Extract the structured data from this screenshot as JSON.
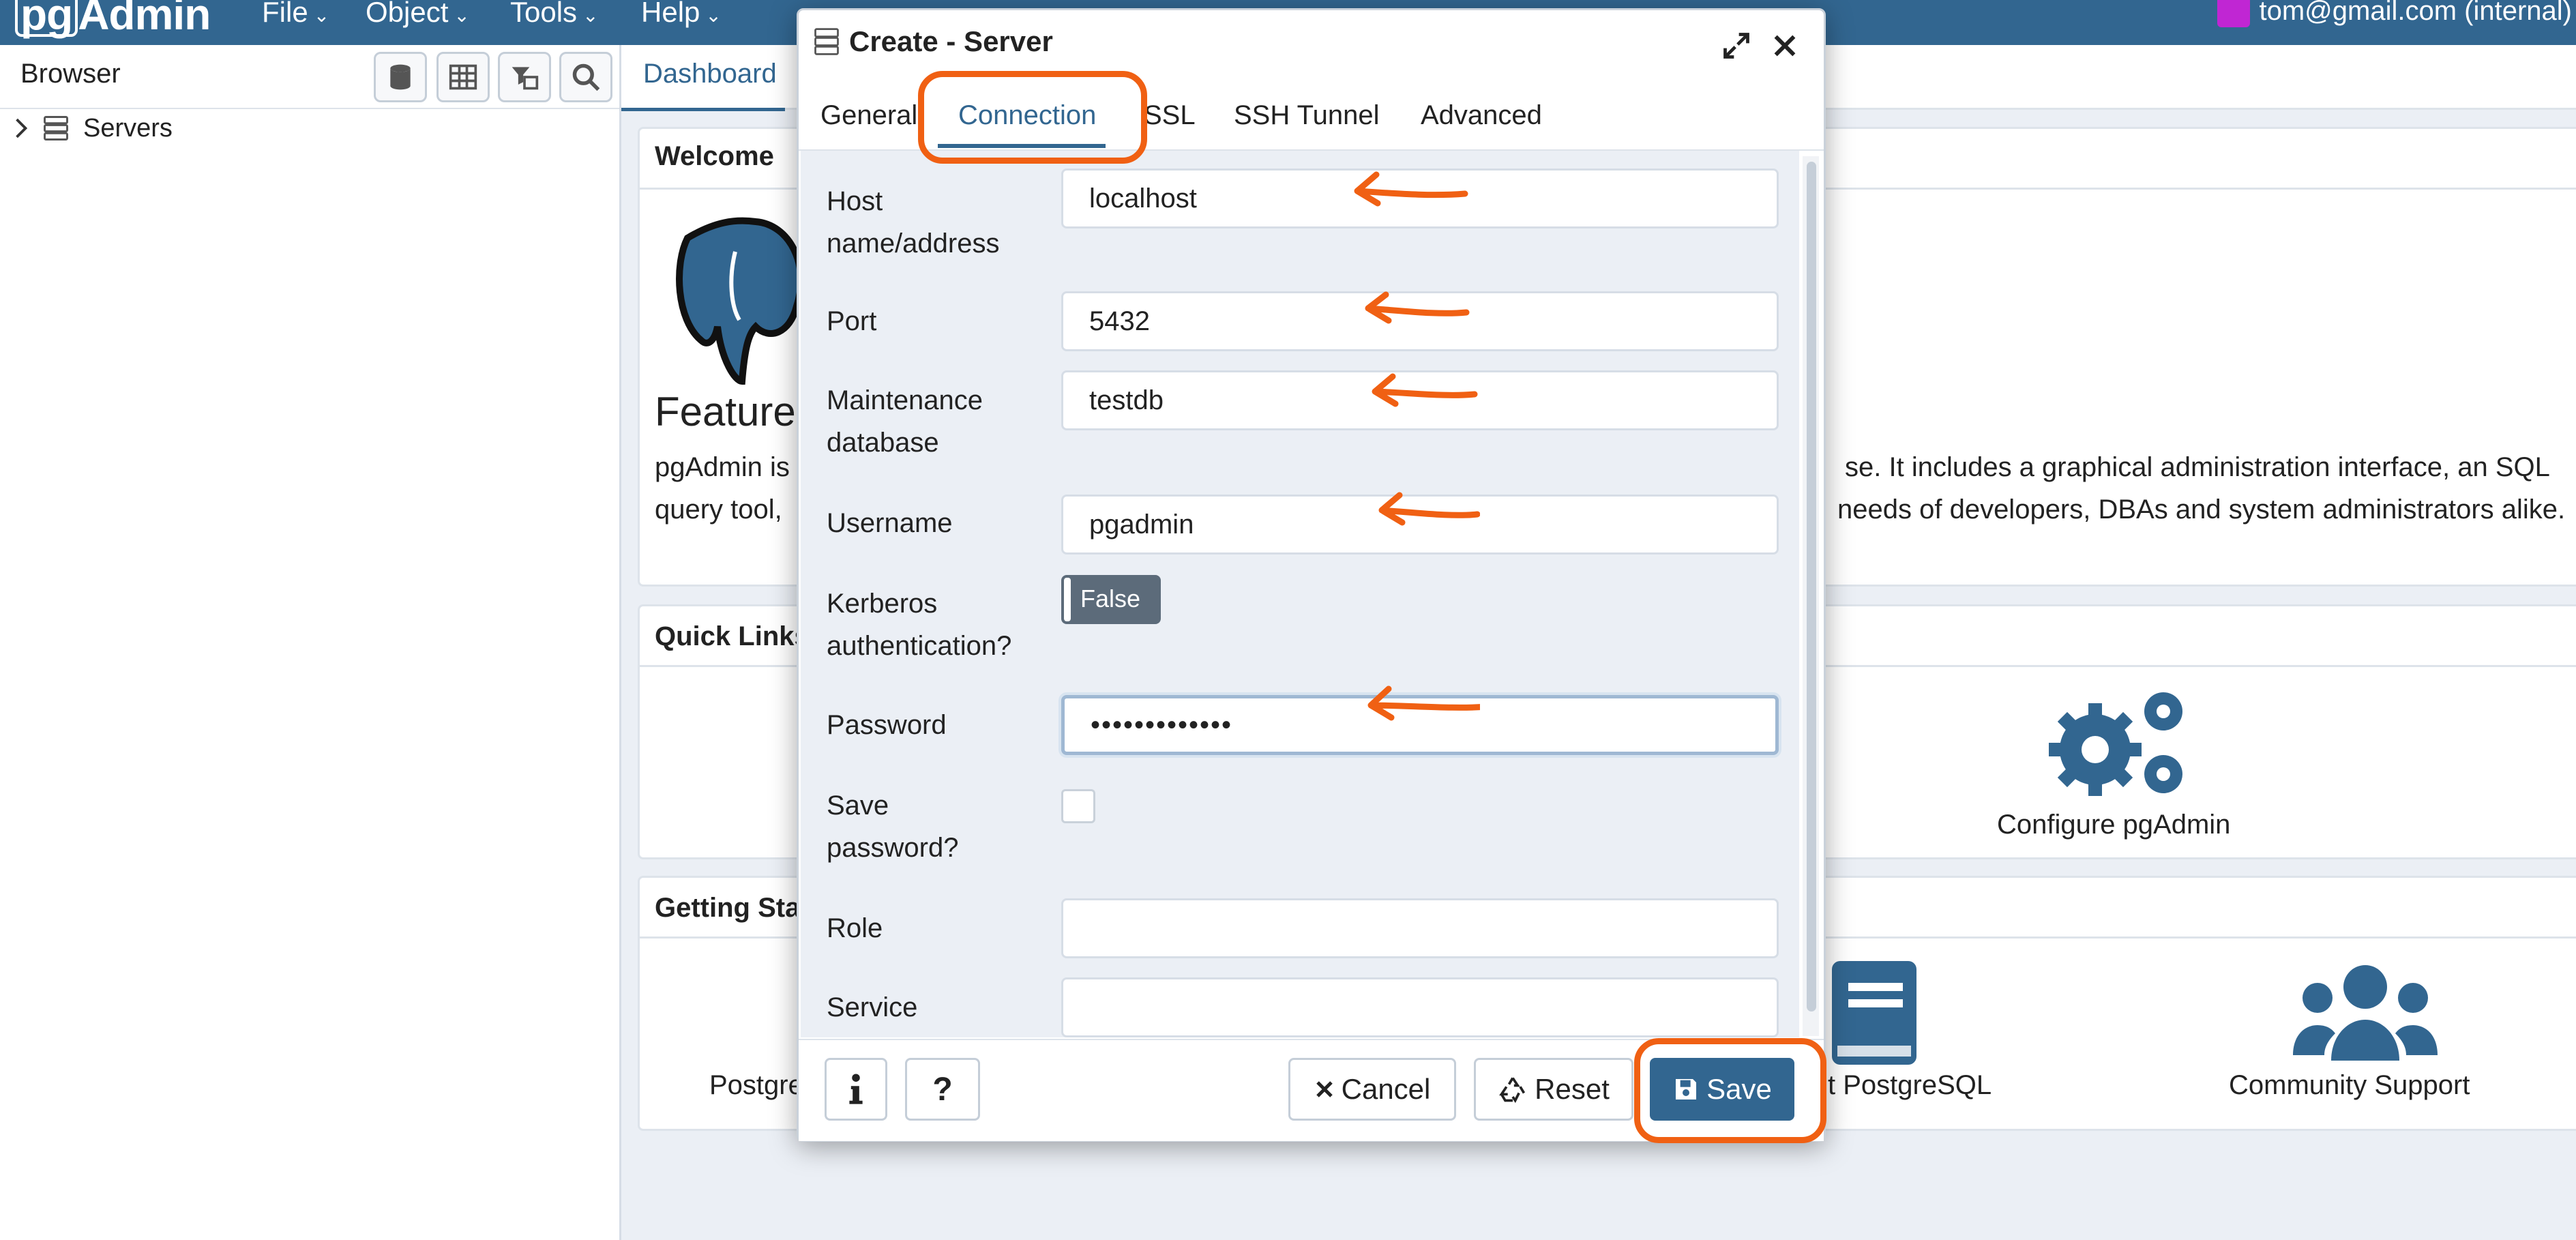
{
  "navbar": {
    "logo": "pgAdmin",
    "menus": [
      {
        "label": "File"
      },
      {
        "label": "Object"
      },
      {
        "label": "Tools"
      },
      {
        "label": "Help"
      }
    ],
    "user": "tom@gmail.com (internal)"
  },
  "browser": {
    "title": "Browser",
    "tree_root": "Servers",
    "toolbar_icons": [
      "database-icon",
      "table-icon",
      "filter-table-icon",
      "search-icon"
    ]
  },
  "main": {
    "tab": "Dashboard",
    "welcome": {
      "title": "Welcome",
      "features_heading": "Feature",
      "text_line1_left": "pgAdmin is",
      "text_line1_right": "se. It includes a graphical administration interface, an SQL",
      "text_line2_left": "query tool,",
      "text_line2_right": "needs of developers, DBAs and system administrators alike."
    },
    "quick_links": {
      "title": "Quick Links",
      "configure_label": "Configure pgAdmin"
    },
    "getting_started": {
      "title": "Getting Sta",
      "item_left": "Postgre",
      "item_planet": "t PostgreSQL",
      "item_community": "Community Support"
    }
  },
  "dialog": {
    "title": "Create - Server",
    "tabs": [
      {
        "label": "General"
      },
      {
        "label": "Connection"
      },
      {
        "label": "SSL"
      },
      {
        "label": "SSH Tunnel"
      },
      {
        "label": "Advanced"
      }
    ],
    "active_tab": "Connection",
    "fields": {
      "host": {
        "label_1": "Host",
        "label_2": "name/address",
        "value": "localhost"
      },
      "port": {
        "label": "Port",
        "value": "5432"
      },
      "maintenance_db": {
        "label_1": "Maintenance",
        "label_2": "database",
        "value": "testdb"
      },
      "username": {
        "label": "Username",
        "value": "pgadmin"
      },
      "kerberos": {
        "label_1": "Kerberos",
        "label_2": "authentication?",
        "value": "False"
      },
      "password": {
        "label": "Password",
        "value": "•••••••••••••"
      },
      "save_password": {
        "label_1": "Save",
        "label_2": "password?",
        "checked": false
      },
      "role": {
        "label": "Role",
        "value": ""
      },
      "service": {
        "label": "Service",
        "value": ""
      }
    },
    "footer": {
      "info_icon": "info-icon",
      "help_label": "?",
      "cancel_label": "Cancel",
      "reset_label": "Reset",
      "save_label": "Save"
    }
  },
  "colors": {
    "brand": "#326690",
    "annotation": "#f06013"
  }
}
